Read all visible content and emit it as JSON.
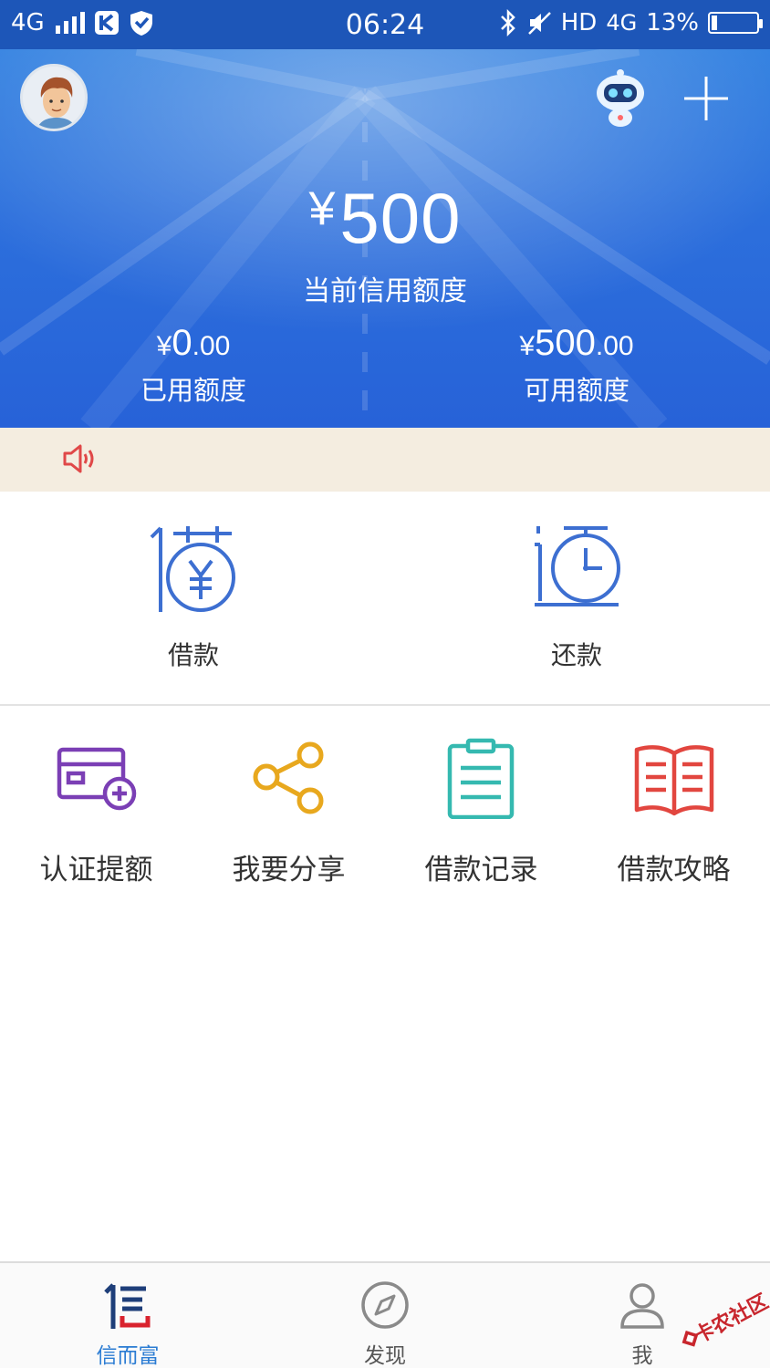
{
  "status_bar": {
    "network": "4G",
    "time": "06:24",
    "hd": "HD",
    "network2": "4G",
    "battery": "13%",
    "battery_level": 0.13
  },
  "header": {
    "currency": "¥",
    "credit_limit": "500",
    "credit_label": "当前信用额度",
    "used": {
      "yen": "¥",
      "int": "0",
      "dec": ".00",
      "label": "已用额度"
    },
    "available": {
      "yen": "¥",
      "int": "500",
      "dec": ".00",
      "label": "可用额度"
    }
  },
  "main_actions": [
    {
      "label": "借款",
      "icon": "borrow-icon"
    },
    {
      "label": "还款",
      "icon": "repay-icon"
    }
  ],
  "grid": [
    {
      "label": "认证提额",
      "icon": "card-add-icon",
      "color": "#7b3fb5"
    },
    {
      "label": "我要分享",
      "icon": "share-icon",
      "color": "#e8a81e"
    },
    {
      "label": "借款记录",
      "icon": "clipboard-icon",
      "color": "#35b9b0"
    },
    {
      "label": "借款攻略",
      "icon": "book-icon",
      "color": "#e2463f"
    }
  ],
  "tabs": [
    {
      "label": "信而富",
      "icon": "brand-icon",
      "active": true
    },
    {
      "label": "发现",
      "icon": "compass-icon",
      "active": false
    },
    {
      "label": "我",
      "icon": "user-icon",
      "active": false
    }
  ],
  "watermark": "卡农社区",
  "colors": {
    "header_blue": "#2c6fdc",
    "accent_blue": "#2b7cd3",
    "notice_bg": "#f4ede0",
    "speaker_red": "#e04848"
  }
}
